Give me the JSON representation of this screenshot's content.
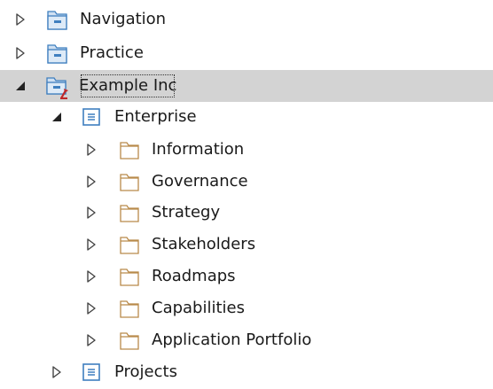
{
  "tree": {
    "nodes": [
      {
        "label": "Navigation",
        "state": "collapsed",
        "icon": "package-icon"
      },
      {
        "label": "Practice",
        "state": "collapsed",
        "icon": "package-icon"
      },
      {
        "label": "Example Inc",
        "state": "expanded",
        "icon": "model-package-icon",
        "selected": true
      },
      {
        "label": "Enterprise",
        "state": "expanded",
        "icon": "view-package-icon"
      },
      {
        "label": "Information",
        "state": "collapsed",
        "icon": "folder-icon"
      },
      {
        "label": "Governance",
        "state": "collapsed",
        "icon": "folder-icon"
      },
      {
        "label": "Strategy",
        "state": "collapsed",
        "icon": "folder-icon"
      },
      {
        "label": "Stakeholders",
        "state": "collapsed",
        "icon": "folder-icon"
      },
      {
        "label": "Roadmaps",
        "state": "collapsed",
        "icon": "folder-icon"
      },
      {
        "label": "Capabilities",
        "state": "collapsed",
        "icon": "folder-icon"
      },
      {
        "label": "Application Portfolio",
        "state": "collapsed",
        "icon": "folder-icon"
      },
      {
        "label": "Projects",
        "state": "collapsed",
        "icon": "view-package-icon"
      }
    ]
  },
  "colors": {
    "selection": "#d3d3d3",
    "package_blue": "#3f7fbf",
    "folder_tan": "#b98a4a",
    "arrow_red": "#c0282a"
  }
}
